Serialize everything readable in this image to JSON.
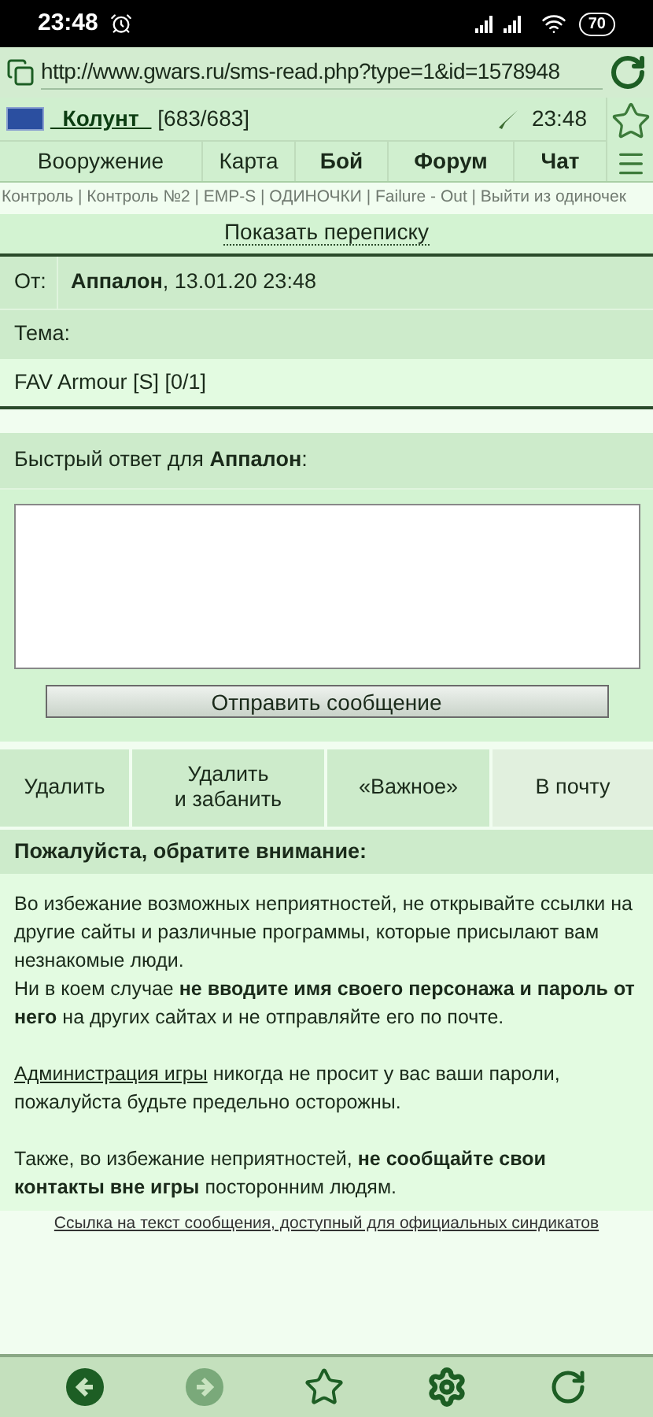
{
  "status_bar": {
    "time": "23:48",
    "battery": "70"
  },
  "address_bar": {
    "url": "http://www.gwars.ru/sms-read.php?type=1&id=1578948"
  },
  "header": {
    "player": "_Колунт_",
    "hp": "[683/683]",
    "time": "23:48"
  },
  "nav": [
    {
      "label": "Вооружение",
      "bold": false
    },
    {
      "label": "Карта",
      "bold": false
    },
    {
      "label": "Бой",
      "bold": true
    },
    {
      "label": "Форум",
      "bold": true
    },
    {
      "label": "Чат",
      "bold": true
    }
  ],
  "quick_links": "Контроль | Контроль №2 | EMP-S | ОДИНОЧКИ | Failure - Out | Выйти из одиночек",
  "show_thread": "Показать переписку",
  "message": {
    "from_label": "От:",
    "from": "**Аппалон**, 13.01.20 23:48",
    "subject_label": "Тема:",
    "subject": "FAV Armour [S] [0/1]"
  },
  "reply": {
    "label": "Быстрый ответ для **Аппалон**:",
    "send": "Отправить сообщение"
  },
  "actions": [
    {
      "label": "Удалить",
      "selected": false
    },
    {
      "label": "Удалить\nи забанить",
      "selected": false
    },
    {
      "label": "«Важное»",
      "selected": false
    },
    {
      "label": "В почту",
      "selected": true
    }
  ],
  "notice": {
    "title": "Пожалуйста, обратите внимание:",
    "paragraphs": [
      {
        "text": "Во избежание возможных неприятностей, не открывайте ссылки на другие сайты и различные программы, которые присылают вам незнакомые люди.\nНи в коем случае **не вводите имя своего персонажа и пароль от него** на других сайтах и не отправляйте его по почте."
      },
      {
        "link": "Администрация игры",
        "text": " никогда не просит у вас ваши пароли, пожалуйста будьте предельно осторожны."
      },
      {
        "text": "Также, во избежание неприятностей, **не сообщайте свои контакты вне игры** посторонним людям."
      }
    ]
  },
  "footer_link": "Ссылка на текст сообщения, доступный для официальных синдикатов",
  "toolbar": [
    {
      "kind": "back",
      "disabled": false
    },
    {
      "kind": "forward",
      "disabled": true
    },
    {
      "kind": "star",
      "disabled": false
    },
    {
      "kind": "settings",
      "disabled": false
    },
    {
      "kind": "reload",
      "disabled": false
    }
  ]
}
